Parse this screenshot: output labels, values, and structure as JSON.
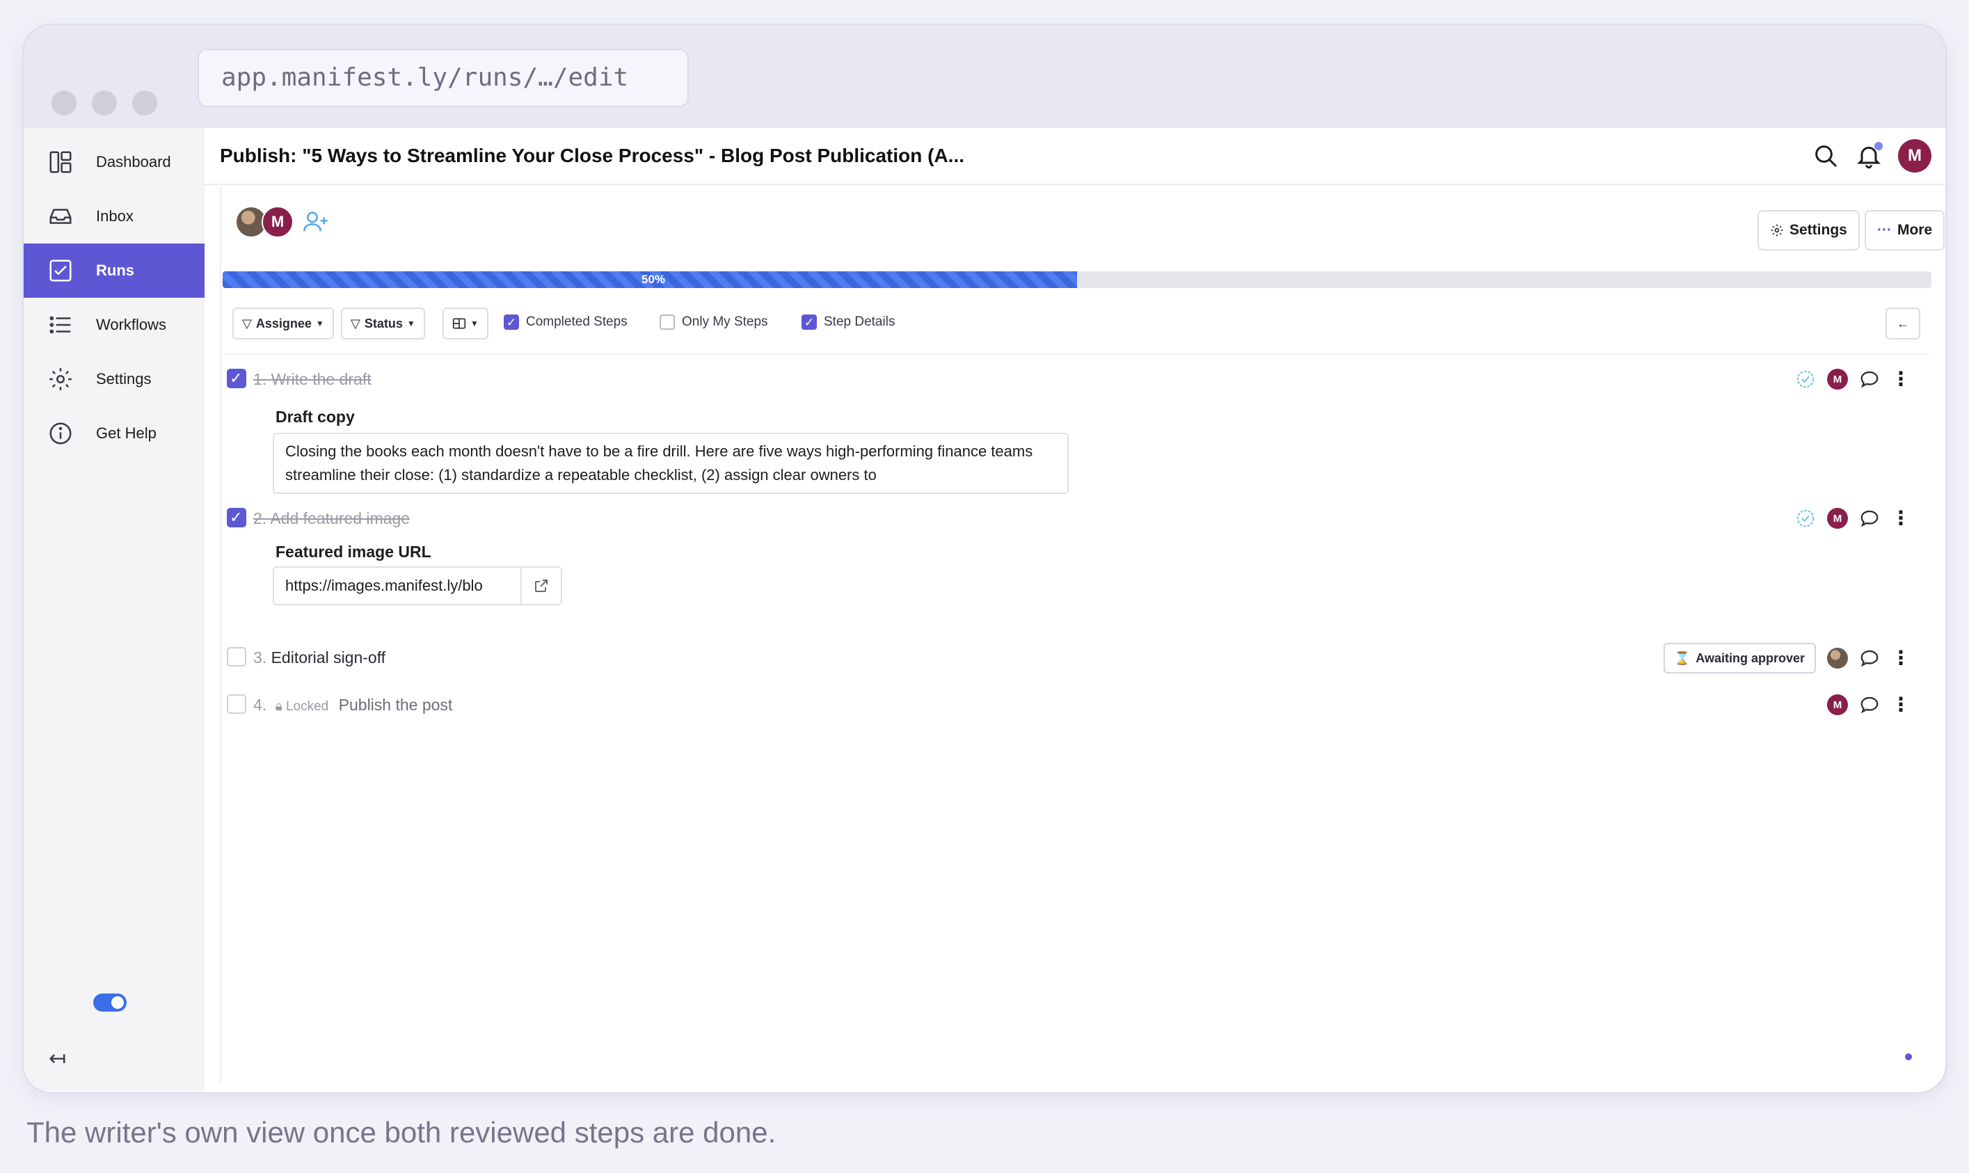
{
  "browser": {
    "url": "app.manifest.ly/runs/…/edit"
  },
  "sidebar": {
    "items": [
      {
        "label": "Dashboard",
        "icon": "dashboard-icon",
        "active": false
      },
      {
        "label": "Inbox",
        "icon": "inbox-icon",
        "active": false
      },
      {
        "label": "Runs",
        "icon": "runs-checkbox-icon",
        "active": true
      },
      {
        "label": "Workflows",
        "icon": "list-icon",
        "active": false
      },
      {
        "label": "Settings",
        "icon": "gear-icon",
        "active": false
      },
      {
        "label": "Get Help",
        "icon": "info-icon",
        "active": false
      }
    ],
    "collapse_glyph": "↤"
  },
  "header": {
    "title": "Publish: \"5 Ways to Streamline Your Close Process\" - Blog Post Publication (A...",
    "user_initial": "M"
  },
  "run": {
    "participant_initial": "M",
    "settings_label": "Settings",
    "more_label": "More",
    "progress": {
      "percent": 50,
      "label": "50%"
    }
  },
  "filters": {
    "assignee_label": "Assignee",
    "status_label": "Status",
    "completed_steps": {
      "label": "Completed Steps",
      "checked": true
    },
    "only_my_steps": {
      "label": "Only My Steps",
      "checked": false
    },
    "step_details": {
      "label": "Step Details",
      "checked": true
    }
  },
  "steps": [
    {
      "number": "1.",
      "title": "Write the draft",
      "completed": true,
      "field_label": "Draft copy",
      "field_value": "Closing the books each month doesn't have to be a fire drill. Here are five ways high-performing finance teams streamline their close: (1) standardize a repeatable checklist, (2) assign clear owners to",
      "assignee_initial": "M"
    },
    {
      "number": "2.",
      "title": "Add featured image",
      "completed": true,
      "field_label": "Featured image URL",
      "field_value": "https://images.manifest.ly/blo",
      "assignee_initial": "M"
    },
    {
      "number": "3.",
      "title": "Editorial sign-off",
      "completed": false,
      "status_badge": "Awaiting approver"
    },
    {
      "number": "4.",
      "title": "Publish the post",
      "completed": false,
      "locked_label": "Locked",
      "assignee_initial": "M"
    }
  ],
  "colors": {
    "accent": "#5d57d4",
    "progress": "#3a66de",
    "avatar": "#8a1f4b"
  },
  "caption": "The writer's own view once both reviewed steps are done."
}
